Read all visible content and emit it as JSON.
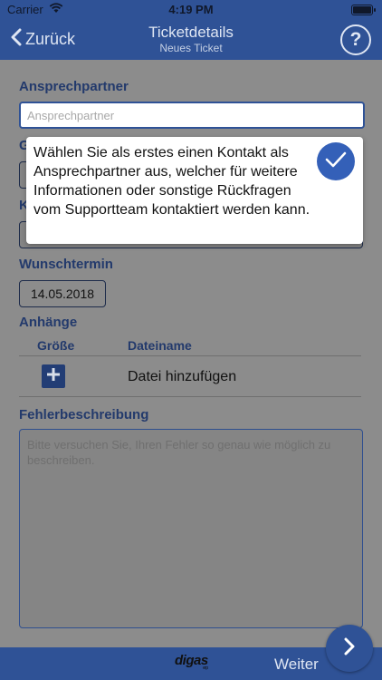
{
  "status_bar": {
    "carrier": "Carrier",
    "time": "4:19 PM"
  },
  "nav": {
    "back_label": "Zurück",
    "title": "Ticketdetails",
    "subtitle": "Neues Ticket",
    "help_symbol": "?"
  },
  "form": {
    "contact": {
      "label": "Ansprechpartner",
      "placeholder": "Ansprechpartner"
    },
    "field2_label_fragment": "G",
    "field3_label_fragment": "K",
    "date": {
      "label": "Wunschtermin",
      "value": "14.05.2018"
    },
    "attachments": {
      "label": "Anhänge",
      "columns": [
        "Größe",
        "Dateiname"
      ],
      "add_label": "Datei hinzufügen"
    },
    "description": {
      "label": "Fehlerbeschreibung",
      "placeholder": "Bitte versuchen Sie, Ihren Fehler so genau wie möglich zu beschreiben."
    }
  },
  "popup": {
    "text": "Wählen Sie als erstes einen Kontakt als Ansprechpartner aus, welcher für weitere Informationen oder sonstige Rückfragen vom Supportteam kontaktiert werden kann."
  },
  "bottom": {
    "logo": "digas",
    "logo_sub": "erp",
    "next_label": "Weiter"
  },
  "colors": {
    "primary": "#2f5296",
    "overlay": "#8c8c8c",
    "label": "#233a6c",
    "confirm": "#3460b8"
  }
}
